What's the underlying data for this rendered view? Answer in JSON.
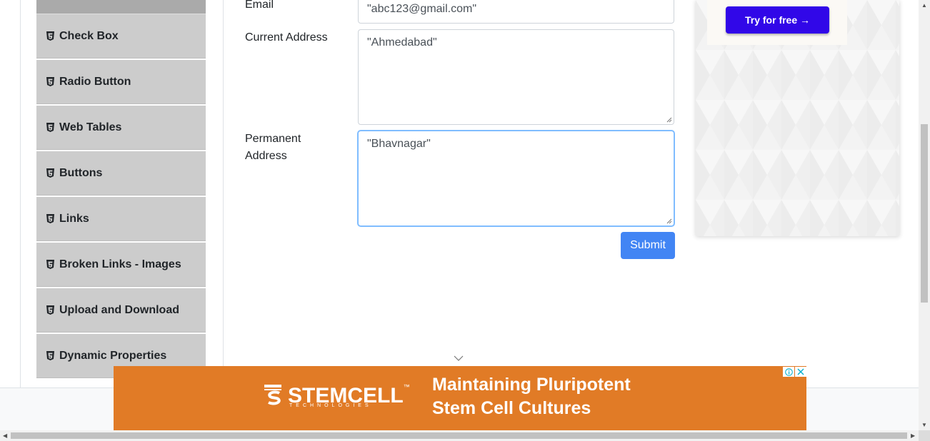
{
  "sidebar": {
    "items": [
      {
        "label": "Check Box"
      },
      {
        "label": "Radio Button"
      },
      {
        "label": "Web Tables"
      },
      {
        "label": "Buttons"
      },
      {
        "label": "Links"
      },
      {
        "label": "Broken Links - Images"
      },
      {
        "label": "Upload and Download"
      },
      {
        "label": "Dynamic Properties"
      }
    ]
  },
  "form": {
    "email_label": "Email",
    "email_value": "\"abc123@gmail.com\"",
    "current_address_label": "Current Address",
    "current_address_value": "\"Ahmedabad\"",
    "permanent_address_label_line1": "Permanent",
    "permanent_address_label_line2": "Address",
    "permanent_address_value": "\"Bhavnagar\"",
    "submit_label": "Submit",
    "submit_color": "#4285f4"
  },
  "side_ad": {
    "button_label": "Try for free →",
    "button_color": "#3107e8"
  },
  "banner_ad": {
    "brand": "STEMCELL",
    "brand_sub": "TECHNOLOGIES",
    "trademark": "™",
    "tagline_line1": "Maintaining Pluripotent",
    "tagline_line2": "Stem Cell Cultures",
    "background_color": "#e17b26",
    "info_icon": "adchoices-icon",
    "close_icon": "close-icon"
  }
}
